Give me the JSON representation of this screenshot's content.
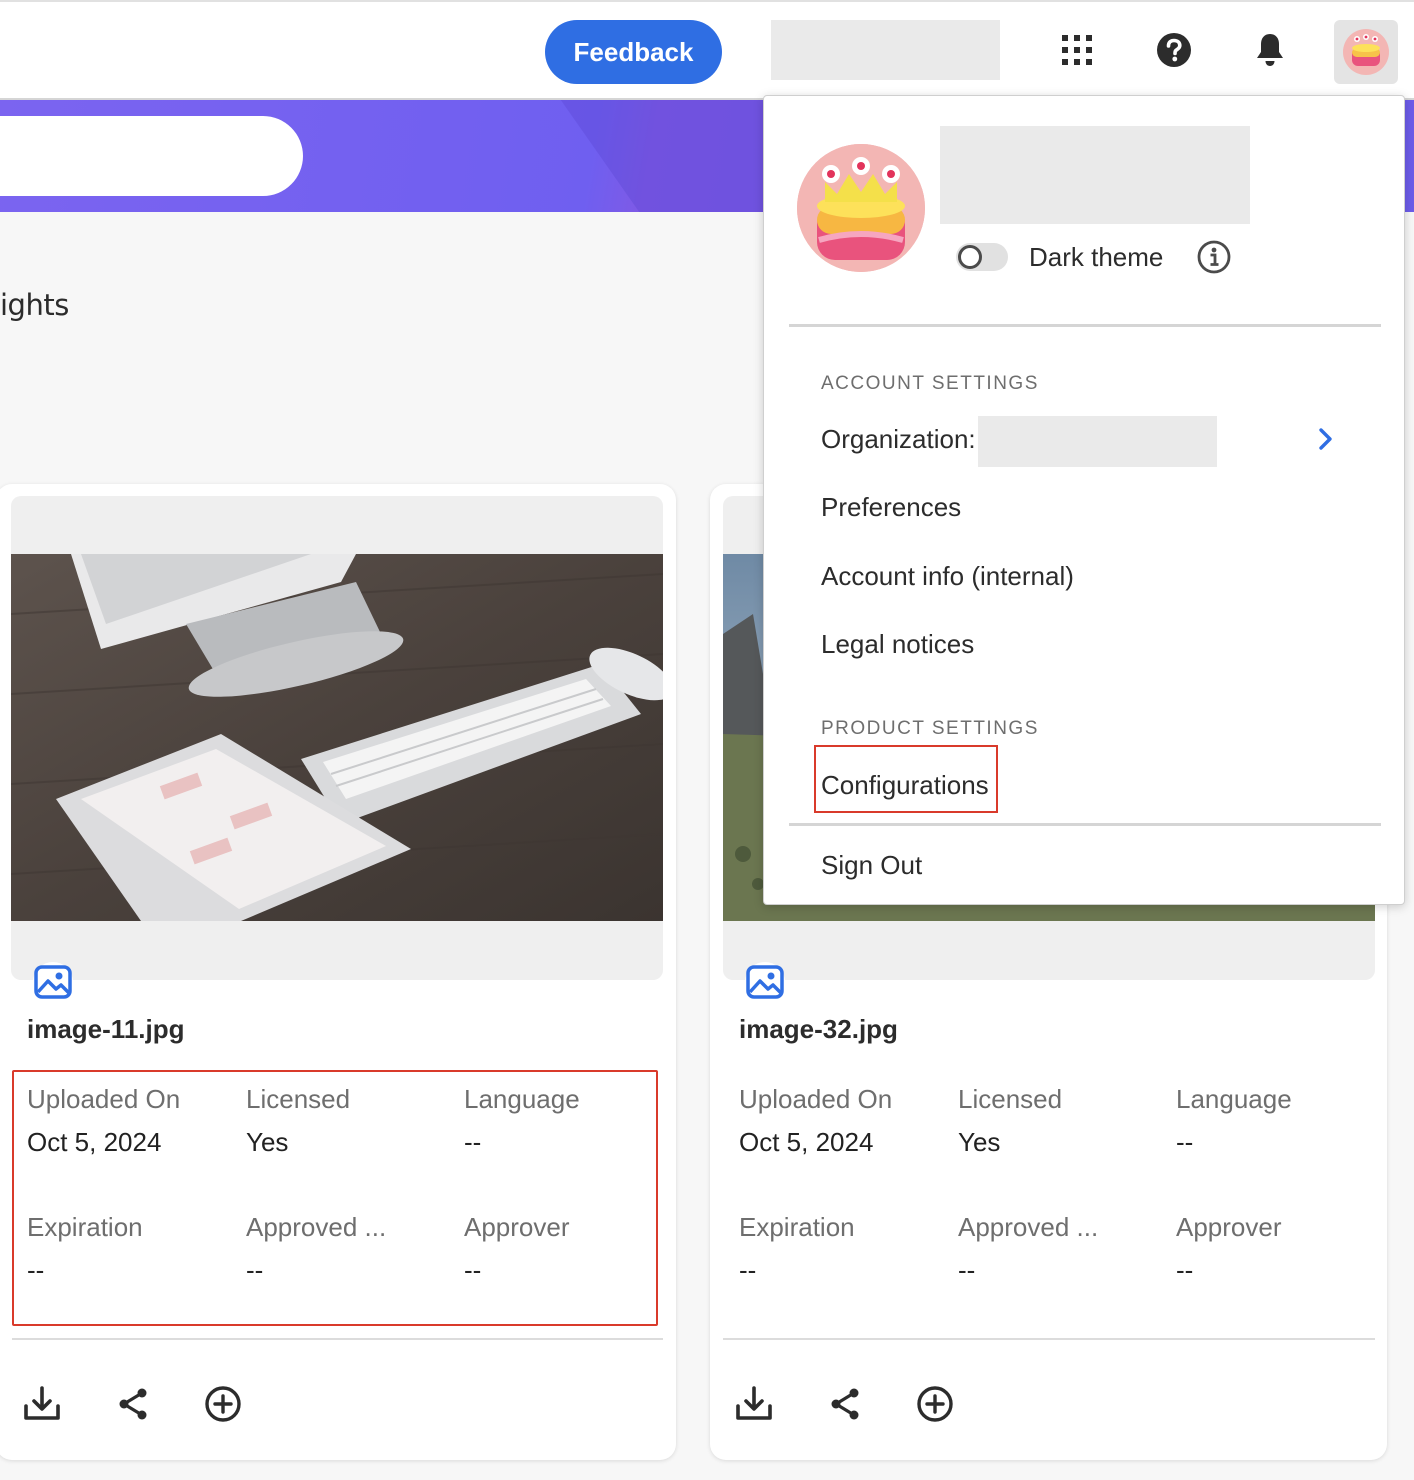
{
  "header": {
    "feedback_label": "Feedback",
    "icons": [
      "apps-grid-icon",
      "help-icon",
      "bell-icon",
      "avatar"
    ]
  },
  "section": {
    "heading_partial": "ights"
  },
  "cards": [
    {
      "file_name": "image-11.jpg",
      "file_type_icon": "image-icon",
      "meta": [
        {
          "label": "Uploaded On",
          "value": "Oct 5, 2024"
        },
        {
          "label": "Licensed",
          "value": "Yes"
        },
        {
          "label": "Language",
          "value": "--"
        },
        {
          "label": "Expiration",
          "value": "--"
        },
        {
          "label": "Approved ...",
          "value": "--"
        },
        {
          "label": "Approver",
          "value": "--"
        }
      ],
      "actions": [
        "download-icon",
        "share-icon",
        "add-circle-icon"
      ]
    },
    {
      "file_name": "image-32.jpg",
      "file_type_icon": "image-icon",
      "meta": [
        {
          "label": "Uploaded On",
          "value": "Oct 5, 2024"
        },
        {
          "label": "Licensed",
          "value": "Yes"
        },
        {
          "label": "Language",
          "value": "--"
        },
        {
          "label": "Expiration",
          "value": "--"
        },
        {
          "label": "Approved ...",
          "value": "--"
        },
        {
          "label": "Approver",
          "value": "--"
        }
      ],
      "actions": [
        "download-icon",
        "share-icon",
        "add-circle-icon"
      ]
    }
  ],
  "menu": {
    "dark_theme_label": "Dark theme",
    "dark_theme_on": false,
    "account_heading": "ACCOUNT SETTINGS",
    "organization_label": "Organization:",
    "items": [
      "Preferences",
      "Account info (internal)",
      "Legal notices"
    ],
    "product_heading": "PRODUCT SETTINGS",
    "configurations_label": "Configurations",
    "sign_out_label": "Sign Out"
  },
  "colors": {
    "accent_blue": "#2f6ee3",
    "banner_purple": "#7b64f0",
    "highlight_red": "#d93a2b"
  }
}
